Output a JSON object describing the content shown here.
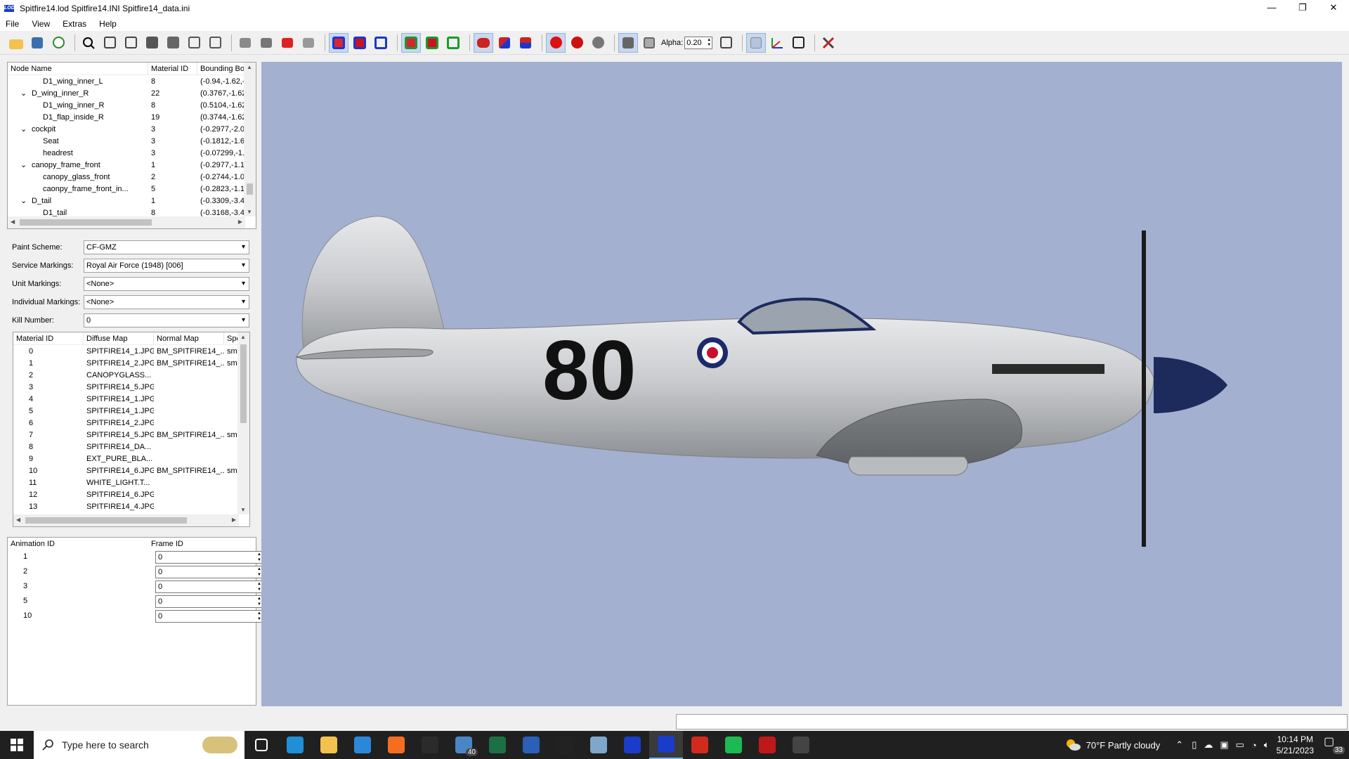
{
  "window": {
    "title": "Spitfire14.lod  Spitfire14.INI  Spitfire14_data.ini",
    "app_icon": "LOD",
    "min": "—",
    "max": "❐",
    "close": "✕"
  },
  "menu": [
    "File",
    "View",
    "Extras",
    "Help"
  ],
  "toolbar": {
    "alpha_label": "Alpha:",
    "alpha_value": "0.20"
  },
  "node_tree": {
    "columns": [
      "Node Name",
      "Material ID",
      "Bounding Bo"
    ],
    "rows": [
      {
        "name": "D1_wing_inner_L",
        "mat": "8",
        "bb": "(-0.94,-1.62,-",
        "indent": 2,
        "exp": ""
      },
      {
        "name": "D_wing_inner_R",
        "mat": "22",
        "bb": "(0.3767,-1.62",
        "indent": 1,
        "exp": "⌄"
      },
      {
        "name": "D1_wing_inner_R",
        "mat": "8",
        "bb": "(0.5104,-1.62",
        "indent": 2,
        "exp": ""
      },
      {
        "name": "D1_flap_inside_R",
        "mat": "19",
        "bb": "(0.3744,-1.62",
        "indent": 2,
        "exp": ""
      },
      {
        "name": "cockpit",
        "mat": "3",
        "bb": "(-0.2977,-2.0",
        "indent": 1,
        "exp": "⌄"
      },
      {
        "name": "Seat",
        "mat": "3",
        "bb": "(-0.1812,-1.6",
        "indent": 2,
        "exp": ""
      },
      {
        "name": "headrest",
        "mat": "3",
        "bb": "(-0.07299,-1.",
        "indent": 2,
        "exp": ""
      },
      {
        "name": "canopy_frame_front",
        "mat": "1",
        "bb": "(-0.2977,-1.1",
        "indent": 1,
        "exp": "⌄"
      },
      {
        "name": "canopy_glass_front",
        "mat": "2",
        "bb": "(-0.2744,-1.0",
        "indent": 2,
        "exp": ""
      },
      {
        "name": "caonpy_frame_front_in...",
        "mat": "5",
        "bb": "(-0.2823,-1.1",
        "indent": 2,
        "exp": ""
      },
      {
        "name": "D_tail",
        "mat": "1",
        "bb": "(-0.3309,-3.4",
        "indent": 1,
        "exp": "⌄"
      },
      {
        "name": "D1_tail",
        "mat": "8",
        "bb": "(-0.3168,-3.4",
        "indent": 2,
        "exp": ""
      }
    ]
  },
  "markings": [
    {
      "label": "Paint Scheme:",
      "value": "CF-GMZ"
    },
    {
      "label": "Service Markings:",
      "value": "Royal Air Force (1948) [006]"
    },
    {
      "label": "Unit Markings:",
      "value": "<None>"
    },
    {
      "label": "Individual Markings:",
      "value": "<None>"
    },
    {
      "label": "Kill Number:",
      "value": "0"
    }
  ],
  "materials": {
    "columns": [
      "Material ID",
      "Diffuse Map",
      "Normal Map",
      "Spe"
    ],
    "rows": [
      {
        "id": "0",
        "d": "SPITFIRE14_1.JPG",
        "n": "BM_SPITFIRE14_...",
        "s": "sm"
      },
      {
        "id": "1",
        "d": "SPITFIRE14_2.JPG",
        "n": "BM_SPITFIRE14_...",
        "s": "sm"
      },
      {
        "id": "2",
        "d": "CANOPYGLASS...",
        "n": "",
        "s": ""
      },
      {
        "id": "3",
        "d": "SPITFIRE14_5.JPG",
        "n": "",
        "s": ""
      },
      {
        "id": "4",
        "d": "SPITFIRE14_1.JPG",
        "n": "",
        "s": ""
      },
      {
        "id": "5",
        "d": "SPITFIRE14_1.JPG",
        "n": "",
        "s": ""
      },
      {
        "id": "6",
        "d": "SPITFIRE14_2.JPG",
        "n": "",
        "s": ""
      },
      {
        "id": "7",
        "d": "SPITFIRE14_5.JPG",
        "n": "BM_SPITFIRE14_...",
        "s": "sm"
      },
      {
        "id": "8",
        "d": "SPITFIRE14_DA...",
        "n": "",
        "s": ""
      },
      {
        "id": "9",
        "d": "EXT_PURE_BLA...",
        "n": "",
        "s": ""
      },
      {
        "id": "10",
        "d": "SPITFIRE14_6.JPG",
        "n": "BM_SPITFIRE14_...",
        "s": "sm"
      },
      {
        "id": "11",
        "d": "WHITE_LIGHT.T...",
        "n": "",
        "s": ""
      },
      {
        "id": "12",
        "d": "SPITFIRE14_6.JPG",
        "n": "",
        "s": ""
      },
      {
        "id": "13",
        "d": "SPITFIRE14_4.JPG",
        "n": "",
        "s": ""
      }
    ]
  },
  "animations": {
    "columns": [
      "Animation ID",
      "Frame ID"
    ],
    "rows": [
      {
        "id": "1",
        "f": "0"
      },
      {
        "id": "2",
        "f": "0"
      },
      {
        "id": "3",
        "f": "0"
      },
      {
        "id": "5",
        "f": "0"
      },
      {
        "id": "10",
        "f": "0"
      }
    ]
  },
  "aircraft": {
    "number": "80",
    "fuselage_color": "#c9cbce",
    "spinner_color": "#1c2a5c",
    "roundel_outer": "#1b2a6b",
    "roundel_leaf": "#c8102e"
  },
  "taskbar": {
    "search_placeholder": "Type here to search",
    "mail_badge": "40",
    "weather": "70°F  Partly cloudy",
    "time": "10:14 PM",
    "date": "5/21/2023",
    "notif_count": "33",
    "icons": [
      {
        "name": "task-view-icon",
        "color": "#202020"
      },
      {
        "name": "edge-icon",
        "color": "#1f8fd6"
      },
      {
        "name": "file-explorer-icon",
        "color": "#f2c14e"
      },
      {
        "name": "store-icon",
        "color": "#2b88d8"
      },
      {
        "name": "firefox-icon",
        "color": "#f56d1f"
      },
      {
        "name": "notion-icon",
        "color": "#2b2b2b"
      },
      {
        "name": "mail-icon",
        "color": "#4a86c5"
      },
      {
        "name": "excel-icon",
        "color": "#1d7044"
      },
      {
        "name": "word-icon",
        "color": "#2b5fb8"
      },
      {
        "name": "7zip-icon",
        "color": "#222222"
      },
      {
        "name": "paint-icon",
        "color": "#7fa7c9"
      },
      {
        "name": "lod-viewer-icon",
        "color": "#1a3cc8"
      },
      {
        "name": "lod-viewer-active-icon",
        "color": "#1a3cc8"
      },
      {
        "name": "acrobat-icon",
        "color": "#d32a1e"
      },
      {
        "name": "spotify-icon",
        "color": "#1db954"
      },
      {
        "name": "mcafee-icon",
        "color": "#c01818"
      },
      {
        "name": "aircraft-app-icon",
        "color": "#444444"
      }
    ]
  }
}
